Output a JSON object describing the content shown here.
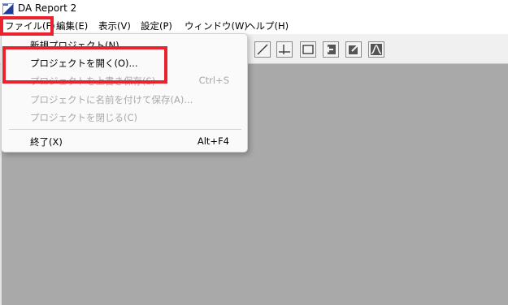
{
  "window": {
    "title": "DA Report 2",
    "icon": "app-logo-icon"
  },
  "menubar": {
    "items": [
      {
        "label": "ファイル(F)"
      },
      {
        "label": "編集(E)"
      },
      {
        "label": "表示(V)"
      },
      {
        "label": "設定(P)"
      },
      {
        "label": "ウィンドウ(W)"
      },
      {
        "label": "ヘルプ(H)"
      }
    ]
  },
  "toolbar": {
    "buttons": [
      {
        "icon": "line-tool-icon"
      },
      {
        "icon": "axis-tool-icon"
      },
      {
        "icon": "rectangle-tool-icon"
      },
      {
        "icon": "import-icon"
      },
      {
        "icon": "edit-icon"
      },
      {
        "icon": "waveform-icon"
      }
    ]
  },
  "file_menu": {
    "items": [
      {
        "label": "新規プロジェクト(N)",
        "shortcut": "",
        "enabled": true
      },
      {
        "label": "プロジェクトを開く(O)...",
        "shortcut": "",
        "enabled": true
      },
      {
        "label": "プロジェクトを上書き保存(S)",
        "shortcut": "Ctrl+S",
        "enabled": false
      },
      {
        "label": "プロジェクトに名前を付けて保存(A)...",
        "shortcut": "",
        "enabled": false
      },
      {
        "label": "プロジェクトを閉じる(C)",
        "shortcut": "",
        "enabled": false
      },
      {
        "label": "終了(X)",
        "shortcut": "Alt+F4",
        "enabled": true
      }
    ]
  },
  "colors": {
    "highlight": "#e8232e",
    "workspace": "#a9a9a9",
    "disabled_text": "#a8a8a8"
  }
}
